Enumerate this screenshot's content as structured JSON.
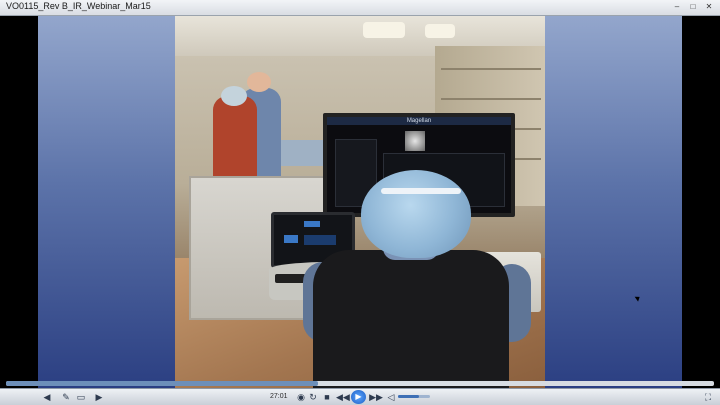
{
  "window": {
    "title": "VO0115_Rev B_IR_Webinar_Mar15"
  },
  "monitor": {
    "title": "Magellan"
  },
  "player": {
    "time": "27:01",
    "progress_fraction": 0.44,
    "volume_fraction": 0.65,
    "icons": [
      "back-arrow-icon",
      "pen-icon",
      "display-icon",
      "forward-arrow-icon",
      "chapter-icon",
      "repeat-icon",
      "stop-icon",
      "rewind-icon",
      "play-icon",
      "fast-forward-icon",
      "volume-icon",
      "fullscreen-icon"
    ]
  }
}
